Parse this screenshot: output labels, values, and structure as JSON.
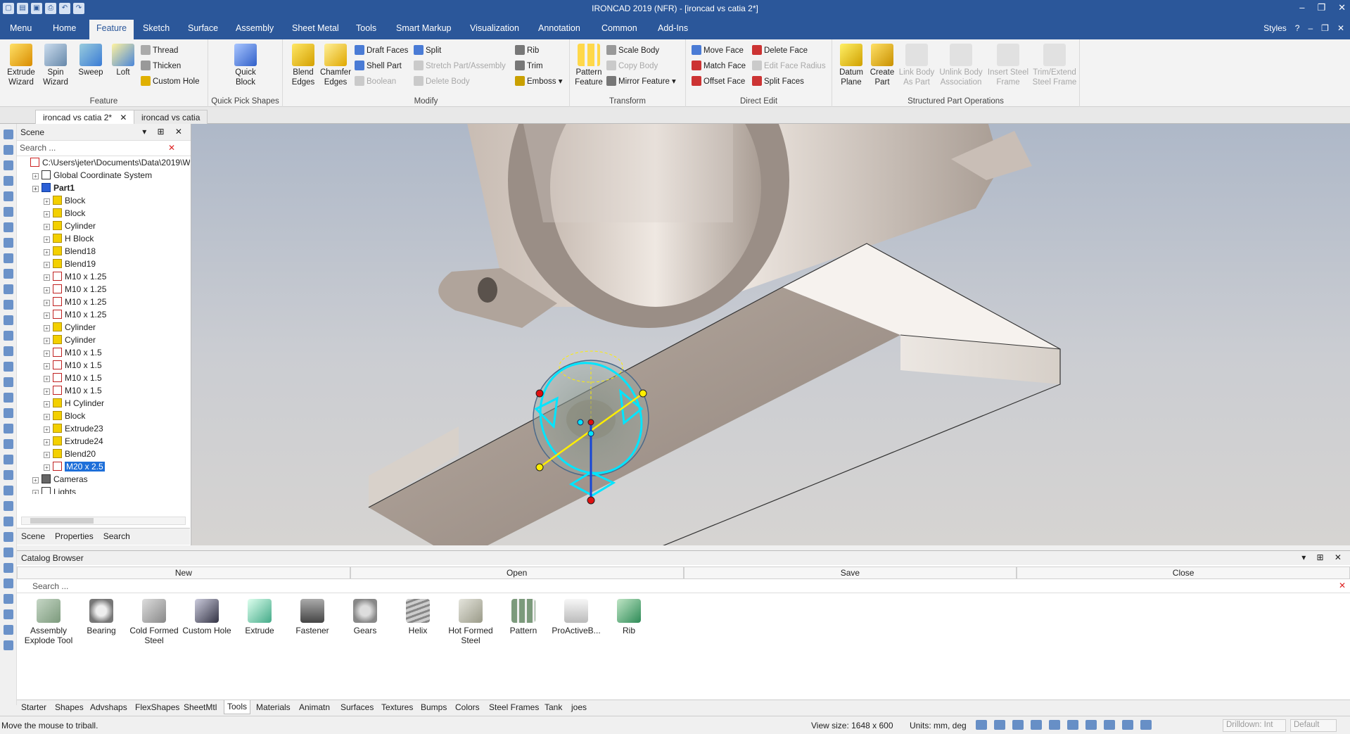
{
  "window": {
    "title": "IRONCAD 2019 (NFR) - [ironcad vs catia 2*]",
    "qat_icons": [
      "new-icon",
      "open-icon",
      "save-icon",
      "print-icon",
      "undo-icon",
      "redo-icon"
    ]
  },
  "menu": {
    "tabs": [
      "Menu",
      "Home",
      "Feature",
      "Sketch",
      "Surface",
      "Assembly",
      "Sheet Metal",
      "Tools",
      "Smart Markup",
      "Visualization",
      "Annotation",
      "Common",
      "Add-Ins"
    ],
    "active_tab": "Feature",
    "styles_label": "Styles"
  },
  "ribbon": {
    "feature": {
      "label": "Feature",
      "extrude": "Extrude Wizard",
      "spin": "Spin Wizard",
      "sweep": "Sweep",
      "loft": "Loft",
      "thread": "Thread",
      "thicken": "Thicken",
      "custom_hole": "Custom Hole"
    },
    "quickpick": {
      "label": "Quick Pick Shapes",
      "quick_block": "Quick Block"
    },
    "modify": {
      "label": "Modify",
      "blend": "Blend Edges",
      "chamfer": "Chamfer Edges",
      "draft": "Draft Faces",
      "shell": "Shell Part",
      "boolean": "Boolean",
      "split": "Split",
      "stretch": "Stretch Part/Assembly",
      "delete_body": "Delete Body",
      "rib": "Rib",
      "trim": "Trim",
      "emboss": "Emboss"
    },
    "transform": {
      "label": "Transform",
      "pattern": "Pattern Feature",
      "scale": "Scale Body",
      "copy": "Copy Body",
      "mirror": "Mirror Feature"
    },
    "directedit": {
      "label": "Direct Edit",
      "move": "Move Face",
      "match": "Match Face",
      "offset": "Offset Face",
      "delete": "Delete Face",
      "edit_radius": "Edit Face Radius",
      "split": "Split Faces"
    },
    "structured": {
      "label": "Structured Part Operations",
      "datum": "Datum Plane",
      "create": "Create Part",
      "link": "Link Body As Part",
      "unlink": "Unlink Body Association",
      "insert": "Insert Steel Frame",
      "trim": "Trim/Extend Steel Frame"
    }
  },
  "doc_tabs": [
    "ironcad vs catia 2*",
    "ironcad vs catia"
  ],
  "scene": {
    "title": "Scene",
    "search_placeholder": "Search ...",
    "tree": [
      {
        "label": "C:\\Users\\jeter\\Documents\\Data\\2019\\W",
        "level": 0,
        "icon": "file"
      },
      {
        "label": "Global Coordinate System",
        "level": 1,
        "icon": "coord"
      },
      {
        "label": "Part1",
        "level": 1,
        "icon": "part",
        "bold": true
      },
      {
        "label": "Block",
        "level": 2,
        "icon": "shape"
      },
      {
        "label": "Block",
        "level": 2,
        "icon": "shape"
      },
      {
        "label": "Cylinder",
        "level": 2,
        "icon": "shape"
      },
      {
        "label": "H Block",
        "level": 2,
        "icon": "shape"
      },
      {
        "label": "Blend18",
        "level": 2,
        "icon": "shape"
      },
      {
        "label": "Blend19",
        "level": 2,
        "icon": "shape"
      },
      {
        "label": "M10 x 1.25",
        "level": 2,
        "icon": "hole"
      },
      {
        "label": "M10 x 1.25",
        "level": 2,
        "icon": "hole"
      },
      {
        "label": "M10 x 1.25",
        "level": 2,
        "icon": "hole"
      },
      {
        "label": "M10 x 1.25",
        "level": 2,
        "icon": "hole"
      },
      {
        "label": "Cylinder",
        "level": 2,
        "icon": "shape"
      },
      {
        "label": "Cylinder",
        "level": 2,
        "icon": "shape"
      },
      {
        "label": "M10 x 1.5",
        "level": 2,
        "icon": "hole"
      },
      {
        "label": "M10 x 1.5",
        "level": 2,
        "icon": "hole"
      },
      {
        "label": "M10 x 1.5",
        "level": 2,
        "icon": "hole"
      },
      {
        "label": "M10 x 1.5",
        "level": 2,
        "icon": "hole"
      },
      {
        "label": "H Cylinder",
        "level": 2,
        "icon": "shape"
      },
      {
        "label": "Block",
        "level": 2,
        "icon": "shape"
      },
      {
        "label": "Extrude23",
        "level": 2,
        "icon": "shape"
      },
      {
        "label": "Extrude24",
        "level": 2,
        "icon": "shape"
      },
      {
        "label": "Blend20",
        "level": 2,
        "icon": "shape"
      },
      {
        "label": "M20 x 2.5",
        "level": 2,
        "icon": "hole",
        "selected": true
      },
      {
        "label": "Cameras",
        "level": 1,
        "icon": "cam"
      },
      {
        "label": "Lights",
        "level": 1,
        "icon": "coord"
      }
    ],
    "tabs": [
      "Scene",
      "Properties",
      "Search"
    ]
  },
  "catalog": {
    "title": "Catalog Browser",
    "buttons": [
      "New",
      "Open",
      "Save",
      "Close"
    ],
    "search_placeholder": "Search ...",
    "items": [
      "Assembly Explode Tool",
      "Bearing",
      "Cold Formed Steel",
      "Custom Hole",
      "Extrude",
      "Fastener",
      "Gears",
      "Helix",
      "Hot Formed Steel",
      "Pattern",
      "ProActiveB...",
      "Rib"
    ],
    "tabs": [
      "Starter",
      "Shapes",
      "Advshaps",
      "FlexShapes",
      "SheetMtl",
      "Tools",
      "Materials",
      "Animatn",
      "Surfaces",
      "Textures",
      "Bumps",
      "Colors",
      "Steel Frames",
      "Tank",
      "joes"
    ],
    "active_tab": "Tools"
  },
  "status": {
    "message": "Move the mouse to triball.",
    "view_size": "View size: 1648 x 600",
    "units": "Units: mm, deg",
    "drilldown": "Drilldown: Int",
    "default": "Default"
  },
  "colors": {
    "accent": "#2b579a",
    "selection": "#1e6fd9",
    "triball": "#00e5ff",
    "handle_yellow": "#ffee00"
  }
}
